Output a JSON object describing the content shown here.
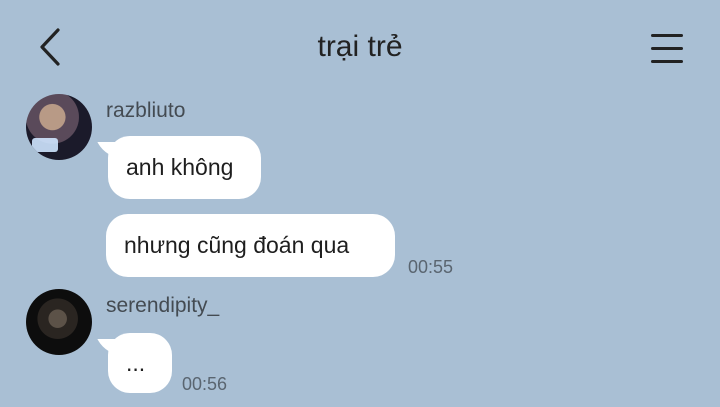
{
  "header": {
    "title": "trại trẻ",
    "back_icon": "chevron-left-icon",
    "menu_icon": "hamburger-menu-icon"
  },
  "messages": [
    {
      "sender": "razbliuto",
      "avatar": "user-avatar",
      "bubbles": [
        {
          "text": "anh không",
          "time": ""
        },
        {
          "text": "nhưng cũng đoán qua",
          "time": "00:55"
        }
      ]
    },
    {
      "sender": "serendipity_",
      "avatar": "user-avatar",
      "bubbles": [
        {
          "text": "...",
          "time": "00:56"
        }
      ]
    }
  ],
  "colors": {
    "background": "#a9bfd4",
    "bubble": "#ffffff",
    "text": "#1e1e1e"
  }
}
